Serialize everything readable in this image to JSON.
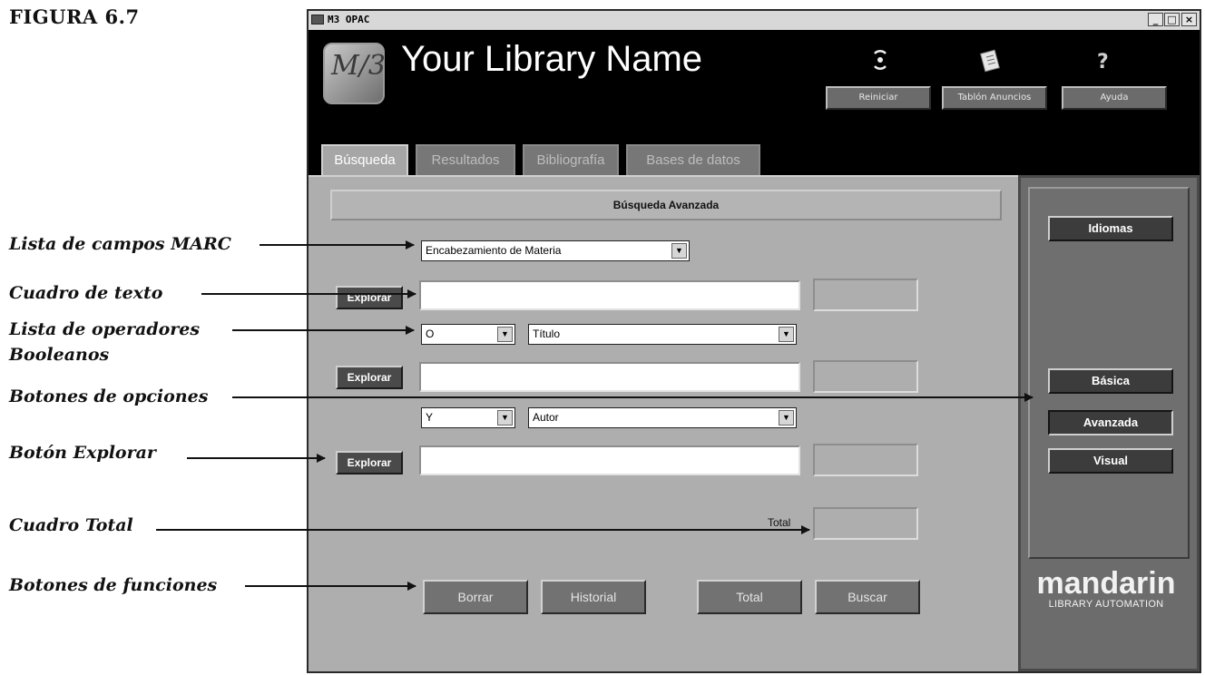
{
  "figure_label": "FIGURA 6.7",
  "annotations": {
    "marc_list": "Lista de campos MARC",
    "text_box": "Cuadro de texto",
    "boolean_list_line1": "Lista de operadores",
    "boolean_list_line2": "Booleanos",
    "option_buttons": "Botones de opciones",
    "explore_button": "Botón Explorar",
    "total_box": "Cuadro Total",
    "function_buttons": "Botones de funciones"
  },
  "window": {
    "title": "M3 OPAC",
    "controls": {
      "minimize": "_",
      "maximize": "□",
      "close": "×"
    }
  },
  "header": {
    "logo_text": "M/3",
    "library_name": "Your Library Name",
    "buttons": [
      {
        "label": "Reiniciar",
        "icon": "reset-icon"
      },
      {
        "label": "Tablón Anuncios",
        "icon": "notice-board-icon"
      },
      {
        "label": "Ayuda",
        "icon": "help-icon"
      }
    ]
  },
  "tabs": [
    {
      "label": "Búsqueda",
      "active": true
    },
    {
      "label": "Resultados",
      "active": false
    },
    {
      "label": "Bibliografía",
      "active": false
    },
    {
      "label": "Bases de datos",
      "active": false
    }
  ],
  "search": {
    "heading": "Búsqueda Avanzada",
    "field1_select": "Encabezamiento de Materia",
    "op1_select": "O",
    "field2_select": "Título",
    "op2_select": "Y",
    "field3_select": "Autor",
    "explore_label": "Explorar",
    "total_label": "Total"
  },
  "functions": {
    "clear": "Borrar",
    "history": "Historial",
    "total": "Total",
    "search": "Buscar"
  },
  "side": {
    "languages": "Idiomas",
    "basic": "Básica",
    "advanced": "Avanzada",
    "visual": "Visual",
    "brand_big": "mandarin",
    "brand_small": "LIBRARY AUTOMATION"
  }
}
